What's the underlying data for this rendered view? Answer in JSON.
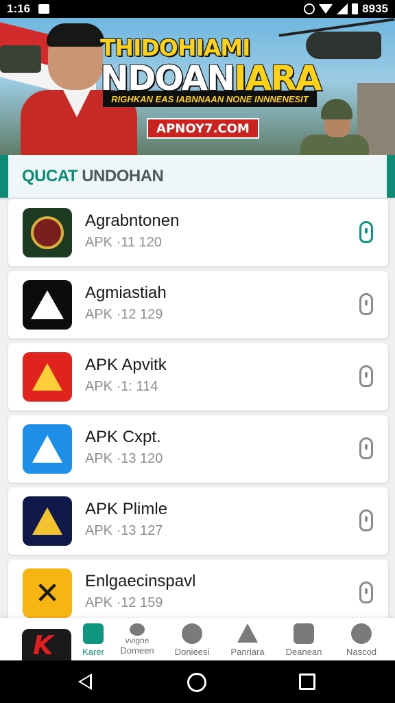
{
  "status_bar": {
    "time": "1:16",
    "right_text": "8935"
  },
  "banner": {
    "title_line1": "THIDOHIAMI",
    "title_line2a": "NDOAN",
    "title_line2b": "IARA",
    "subtitle": "RIGHKAN EAS IABNNAAN NONE INNNENESIT",
    "url": "APNOY7.COM"
  },
  "section": {
    "title_prefix": "QUCAT",
    "title_rest": " UNDOHAN"
  },
  "apps": [
    {
      "name": "Agrabntonen",
      "meta": "APK ·11 120",
      "icon": "green-emblem-icon",
      "active": true
    },
    {
      "name": "Agmiastiah",
      "meta": "APK ·12 129",
      "icon": "black-a-icon",
      "active": false
    },
    {
      "name": "APK Apvitk",
      "meta": "APK ·1: 114",
      "icon": "red-a-icon",
      "active": false
    },
    {
      "name": "APK Cxpt.",
      "meta": "APK ·13 120",
      "icon": "blue-a-icon",
      "active": false
    },
    {
      "name": "APK Plimle",
      "meta": "APK ·13 127",
      "icon": "navy-a-icon",
      "active": false
    },
    {
      "name": "Enlgaecinspavl",
      "meta": "APK ·12 159",
      "icon": "yellow-x-icon",
      "active": false
    }
  ],
  "bottom_nav": [
    {
      "label": "Karer",
      "icon": "edit-icon",
      "active": true
    },
    {
      "label": "Domeen",
      "top": "vvigne",
      "icon": "people-icon",
      "active": false
    },
    {
      "label": "Donieesi",
      "icon": "compass-icon",
      "active": false
    },
    {
      "label": "Panriara",
      "icon": "triangle-icon",
      "active": false
    },
    {
      "label": "Deanean",
      "icon": "image-icon",
      "active": false
    },
    {
      "label": "Nascod",
      "icon": "user-icon",
      "active": false
    }
  ],
  "colors": {
    "accent": "#10957f",
    "banner_yellow": "#ffd21a",
    "banner_red": "#c8231e"
  }
}
